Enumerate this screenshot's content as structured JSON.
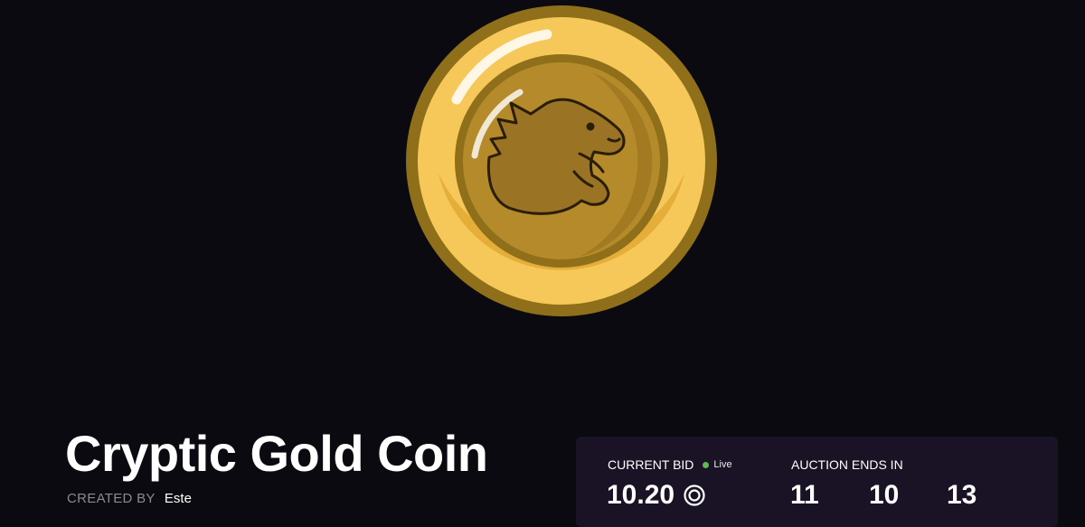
{
  "artwork": {
    "title": "Cryptic Gold Coin",
    "image_icon": "gold-coin-dinosaur-icon"
  },
  "creator": {
    "label": "CREATED BY",
    "name": "Este"
  },
  "auction": {
    "current_bid_label": "CURRENT BID",
    "live_label": "Live",
    "bid_value": "10.20",
    "currency_icon": "currency-ring-icon",
    "ends_label": "AUCTION ENDS IN",
    "countdown": [
      "11",
      "10",
      "13"
    ]
  },
  "colors": {
    "background": "#0a0a10",
    "card": "#1a1325",
    "live": "#5dbb52",
    "coin_outer": "#f6c859",
    "coin_rim": "#8f6f1a",
    "coin_inner": "#b58a2a"
  }
}
